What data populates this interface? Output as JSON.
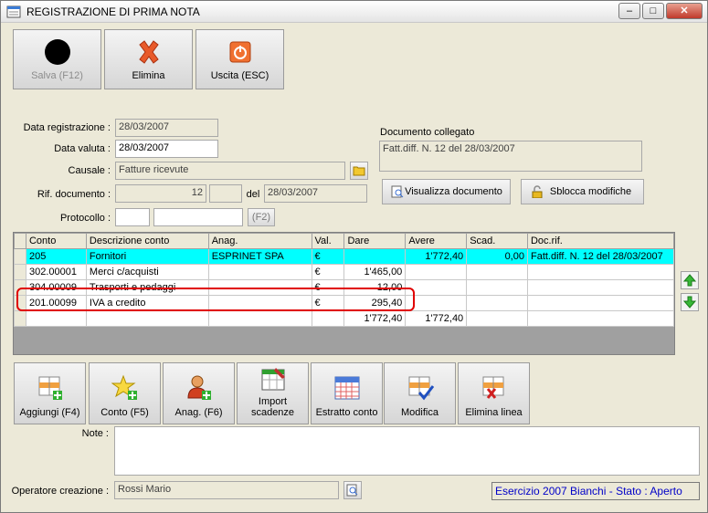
{
  "window": {
    "title": "REGISTRAZIONE DI PRIMA NOTA",
    "min_label": "–",
    "max_label": "□",
    "close_label": "✕"
  },
  "toolbar": {
    "save_label": "Salva (F12)",
    "delete_label": "Elimina",
    "exit_label": "Uscita (ESC)"
  },
  "form": {
    "data_registrazione_label": "Data registrazione :",
    "data_registrazione_value": "28/03/2007",
    "data_valuta_label": "Data valuta :",
    "data_valuta_value": "28/03/2007",
    "causale_label": "Causale :",
    "causale_value": "Fatture ricevute",
    "rif_documento_label": "Rif. documento :",
    "rif_numero_value": "12",
    "rif_suffix_value": "",
    "del_label": "del",
    "rif_data_value": "28/03/2007",
    "protocollo_label": "Protocollo :",
    "protocollo_value": "",
    "protocollo_extra_value": "",
    "f2_label": "(F2)"
  },
  "documento": {
    "group_label": "Documento collegato",
    "value": "Fatt.diff. N. 12 del 28/03/2007",
    "visualizza_label": "Visualizza documento",
    "sblocca_label": "Sblocca modifiche"
  },
  "grid": {
    "headers": [
      "Conto",
      "Descrizione conto",
      "Anag.",
      "Val.",
      "Dare",
      "Avere",
      "Scad.",
      "Doc.rif."
    ],
    "rows": [
      [
        "205",
        "Fornitori",
        "ESPRINET SPA",
        "€",
        "",
        "1'772,40",
        "0,00",
        "Fatt.diff. N. 12 del 28/03/2007"
      ],
      [
        "302.00001",
        "Merci c/acquisti",
        "",
        "€",
        "1'465,00",
        "",
        "",
        ""
      ],
      [
        "304.00009",
        "Trasporti e pedaggi",
        "",
        "€",
        "12,00",
        "",
        "",
        ""
      ],
      [
        "201.00099",
        "IVA a credito",
        "",
        "€",
        "295,40",
        "",
        "",
        ""
      ],
      [
        "",
        "",
        "",
        "",
        "1'772,40",
        "1'772,40",
        "",
        ""
      ]
    ]
  },
  "bottom_buttons": {
    "aggiungi": "Aggiungi (F4)",
    "conto": "Conto (F5)",
    "anag": "Anag. (F6)",
    "import_line1": "Import",
    "import_line2": "scadenze",
    "estratto": "Estratto conto",
    "modifica": "Modifica",
    "elimina_linea": "Elimina linea"
  },
  "note": {
    "label": "Note :",
    "value": ""
  },
  "operatore": {
    "label": "Operatore creazione :",
    "value": "Rossi Mario"
  },
  "status": {
    "text": "Esercizio 2007 Bianchi - Stato : Aperto"
  },
  "colors": {
    "selected_row": "#00ffff",
    "highlight": "#e00000",
    "status_text": "#0000c8"
  }
}
